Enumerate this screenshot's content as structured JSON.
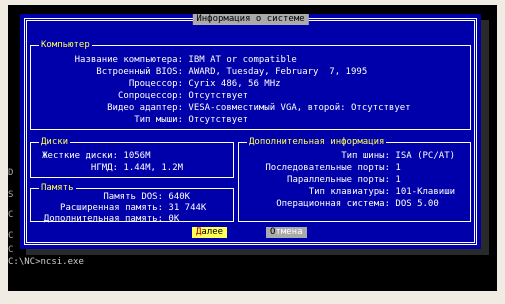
{
  "dialog": {
    "title": "Информация о системе"
  },
  "computer": {
    "title": "Компьютер",
    "rows": [
      {
        "label": "Название компьютера:",
        "value": "IBM AT or compatible"
      },
      {
        "label": "Встроенный BIOS:",
        "value": "AWARD, Tuesday, February  7, 1995"
      },
      {
        "label": "Процессор:",
        "value": "Cyrix 486, 56 MHz"
      },
      {
        "label": "Сопроцессор:",
        "value": "Отсутствует"
      },
      {
        "label": "Видео адаптер:",
        "value": "VESA-совместимый VGA, второй: Отсутствует"
      },
      {
        "label": "Тип мыши:",
        "value": "Отсутствует"
      }
    ]
  },
  "disks": {
    "title": "Диски",
    "rows": [
      {
        "label": "Жесткие диски:",
        "value": "1056M"
      },
      {
        "label": "НГМД:",
        "value": "1.44M, 1.2M"
      }
    ]
  },
  "memory": {
    "title": "Память",
    "rows": [
      {
        "label": "Память DOS:",
        "value": "640K"
      },
      {
        "label": "Расширенная память:",
        "value": "31 744K"
      },
      {
        "label": "Дополнительная память:",
        "value": "0K"
      }
    ]
  },
  "extra": {
    "title": "Дополнительная информация",
    "rows": [
      {
        "label": "Тип шины:",
        "value": "ISA (PC/AT)"
      },
      {
        "label": "Последовательные порты:",
        "value": "1"
      },
      {
        "label": "Параллельные порты:",
        "value": "1"
      },
      {
        "label": "Тип клавиатуры:",
        "value": "101-Клавиши"
      },
      {
        "label": "Операционная система:",
        "value": "DOS 5.00"
      }
    ]
  },
  "buttons": {
    "ok_hot": "Д",
    "ok_rest": "алее",
    "cancel_hot": "О",
    "cancel_rest": "тмена"
  },
  "background": {
    "edge_letters": [
      "D",
      "S",
      "C",
      "C",
      "C"
    ],
    "prompt": "C:\\NC>ncsi.exe"
  },
  "colors": {
    "dialog_bg": "#0000aa",
    "group_title": "#ffff55",
    "button_ok": "#ffff55",
    "button_cancel": "#aaaaaa"
  }
}
